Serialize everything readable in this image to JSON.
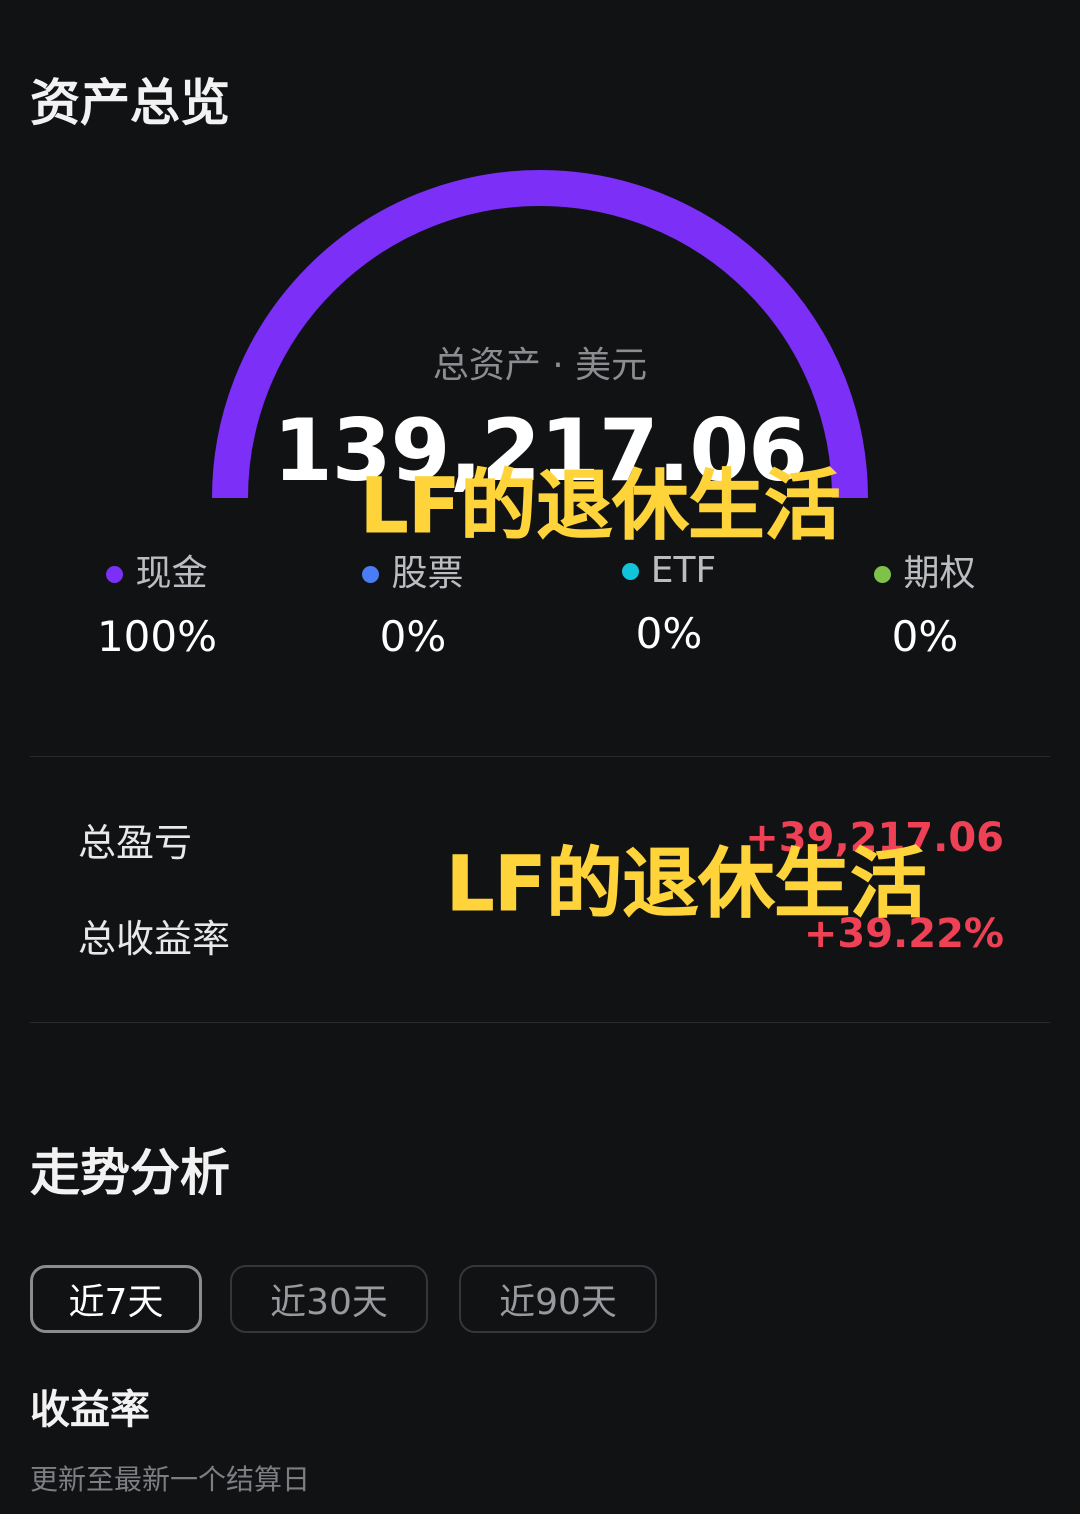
{
  "overview": {
    "title": "资产总览",
    "gauge": {
      "caption": "总资产 · 美元",
      "total": "139,217.06",
      "fill_fraction": 1.0,
      "color": "#7b2ff7"
    },
    "legend": [
      {
        "label": "现金",
        "percent": "100%",
        "color": "#7b2ff7"
      },
      {
        "label": "股票",
        "percent": "0%",
        "color": "#4a7cf5"
      },
      {
        "label": "ETF",
        "percent": "0%",
        "color": "#12c4d9"
      },
      {
        "label": "期权",
        "percent": "0%",
        "color": "#7ec24a"
      }
    ]
  },
  "watermark": {
    "text": "LF的退休生活",
    "color": "#ffd43b"
  },
  "pnl": {
    "total_pnl_label": "总盈亏",
    "total_pnl_value": "+39,217.06",
    "total_return_label": "总收益率",
    "total_return_value": "+39.22%",
    "positive_color": "#ef4156"
  },
  "trend": {
    "title": "走势分析",
    "ranges": [
      {
        "label": "近7天",
        "active": true
      },
      {
        "label": "近30天",
        "active": false
      },
      {
        "label": "近90天",
        "active": false
      }
    ],
    "chart_title": "收益率",
    "update_note": "更新至最新一个结算日"
  }
}
